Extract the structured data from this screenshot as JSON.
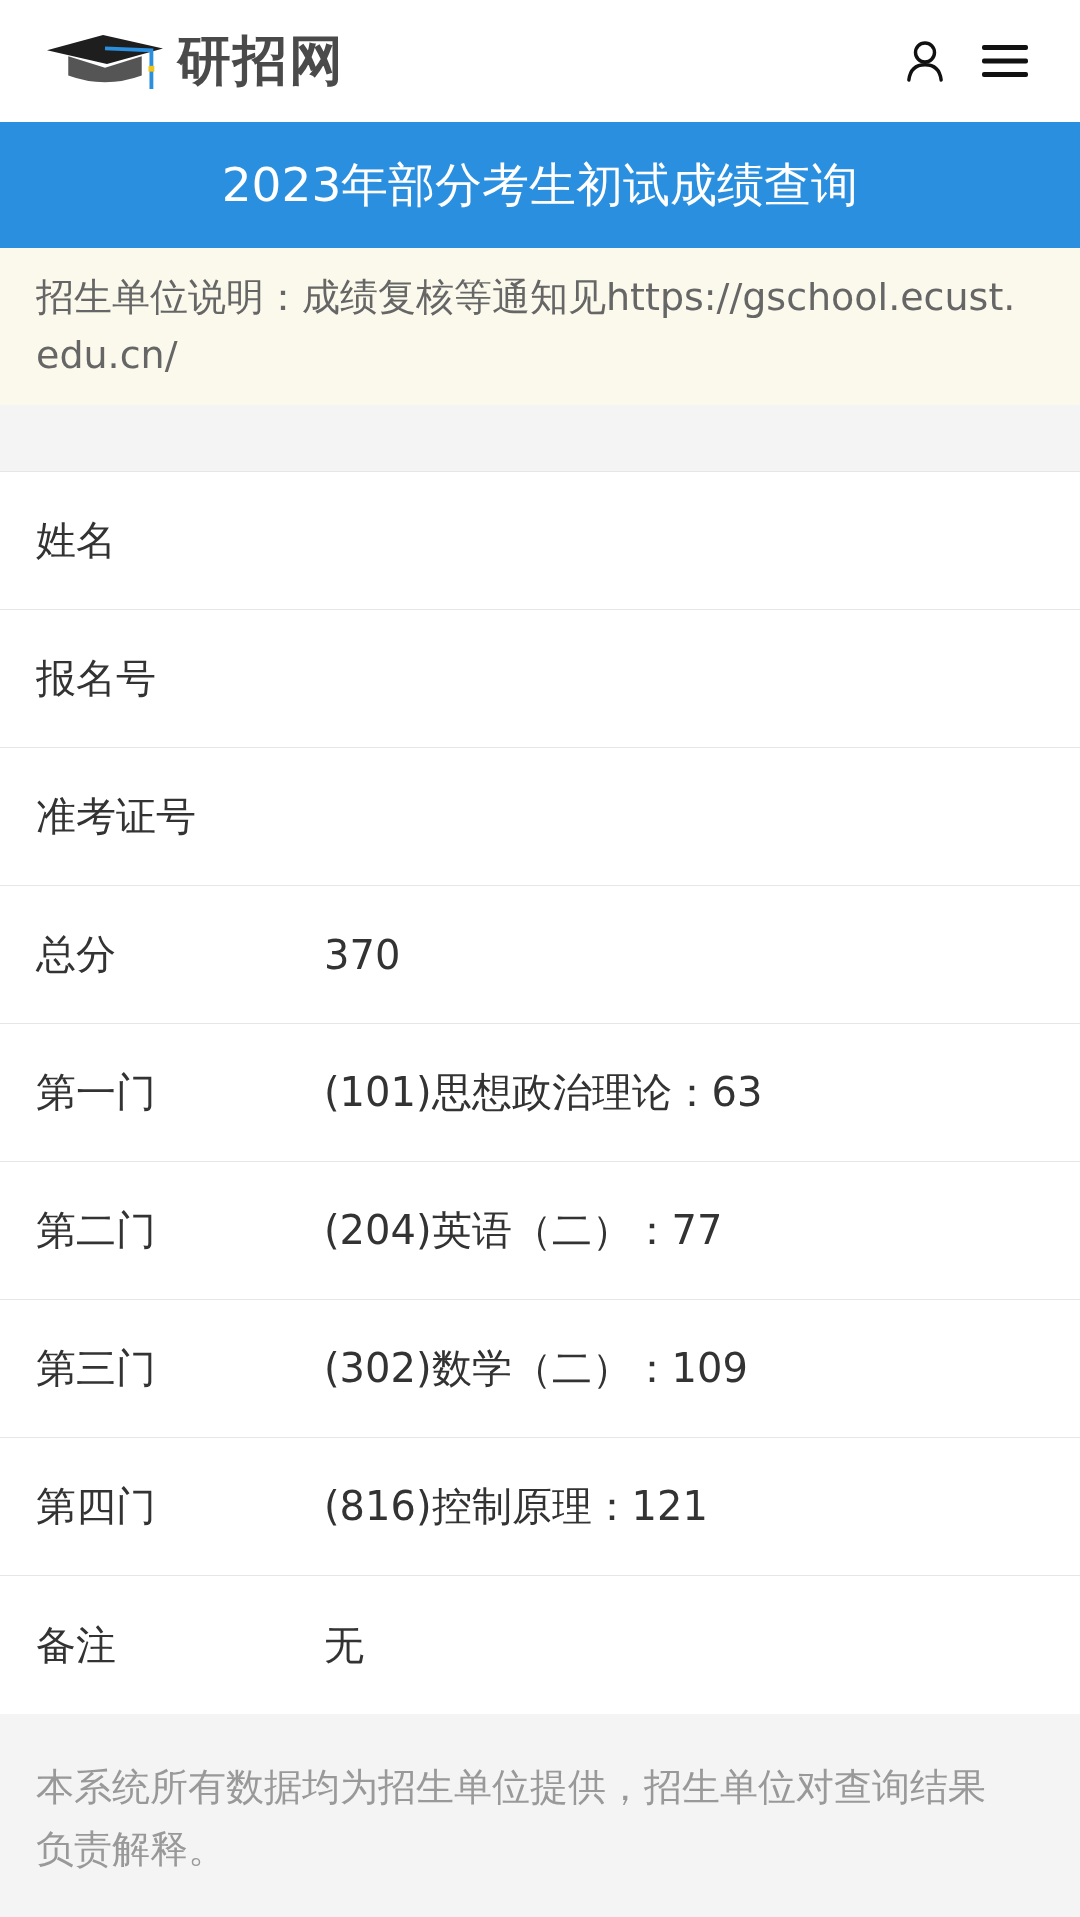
{
  "header": {
    "logo_text": "研招网"
  },
  "banner": {
    "title": "2023年部分考生初试成绩查询"
  },
  "notice": {
    "text": "招生单位说明：成绩复核等通知见https://gschool.ecust.edu.cn/"
  },
  "rows": [
    {
      "label": "姓名"
    },
    {
      "label": "报名号"
    },
    {
      "label": "准考证号"
    },
    {
      "label": "总分",
      "value": "370"
    },
    {
      "label": "第一门",
      "value": "(101)思想政治理论：63"
    },
    {
      "label": "第二门",
      "value": "(204)英语（二）：77"
    },
    {
      "label": "第三门",
      "value": "(302)数学（二）：109"
    },
    {
      "label": "第四门",
      "value": "(816)控制原理：121"
    },
    {
      "label": "备注",
      "value": "无"
    }
  ],
  "footer": {
    "text": "本系统所有数据均为招生单位提供，招生单位对查询结果负责解释。"
  }
}
